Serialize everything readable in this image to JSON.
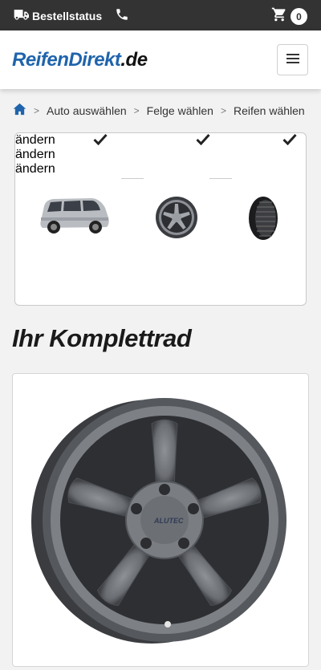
{
  "topbar": {
    "order_status_label": "Bestellstatus",
    "cart_count": "0"
  },
  "header": {
    "logo_part1": "ReifenDirekt",
    "logo_part2": ".de"
  },
  "breadcrumb": {
    "items": [
      "Auto auswählen",
      "Felge wählen",
      "Reifen wählen"
    ]
  },
  "steps": [
    {
      "name": "car",
      "link": "ändern"
    },
    {
      "name": "rim",
      "link": "ändern"
    },
    {
      "name": "tire",
      "link": "ändern"
    }
  ],
  "main": {
    "title": "Ihr Komplettrad"
  },
  "colors": {
    "topbar": "#333333",
    "brand_blue": "#1f64ac",
    "link": "#3d6690"
  }
}
